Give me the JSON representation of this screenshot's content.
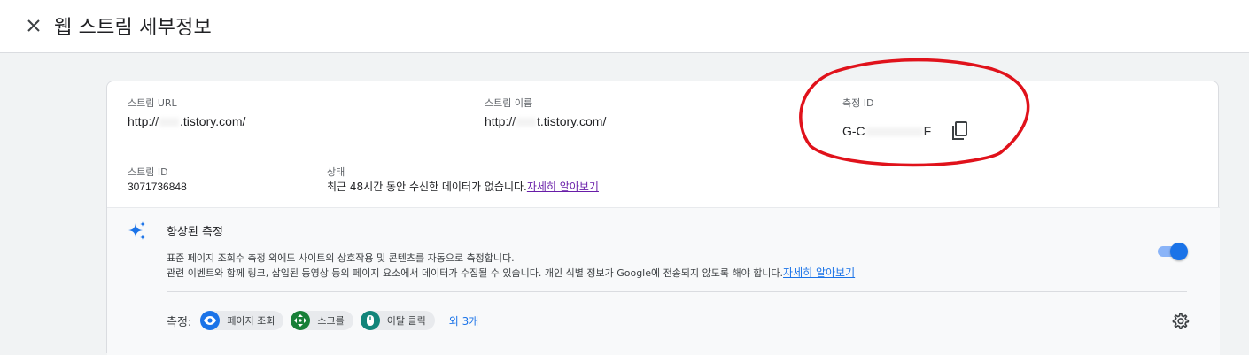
{
  "header": {
    "title": "웹 스트림 세부정보",
    "close_icon": "close-icon"
  },
  "stream": {
    "url_label": "스트림 URL",
    "url_prefix": "http://",
    "url_suffix": ".tistory.com/",
    "name_label": "스트림 이름",
    "name_prefix": "http://",
    "name_suffix": "t.tistory.com/",
    "measurement_label": "측정 ID",
    "measurement_prefix": "G-C",
    "measurement_suffix": "F",
    "id_label": "스트림 ID",
    "id_value": "3071736848",
    "status_label": "상태",
    "status_text": "최근 48시간 동안 수신한 데이터가 없습니다.",
    "status_link": "자세히 알아보기"
  },
  "enhanced": {
    "title": "향상된 측정",
    "desc_line1": "표준 페이지 조회수 측정 외에도 사이트의 상호작용 및 콘텐츠를 자동으로 측정합니다.",
    "desc_line2": "관련 이벤트와 함께 링크, 삽입된 동영상 등의 페이지 요소에서 데이터가 수집될 수 있습니다. 개인 식별 정보가 Google에 전송되지 않도록 해야 합니다.",
    "desc_link": "자세히 알아보기",
    "toggle_on": true,
    "events_label": "측정:",
    "chips": [
      {
        "label": "페이지 조회",
        "icon": "eye-icon",
        "color": "#1a73e8"
      },
      {
        "label": "스크롤",
        "icon": "scroll-arrows-icon",
        "color": "#188038"
      },
      {
        "label": "이탈 클릭",
        "icon": "mouse-icon",
        "color": "#12b5cb"
      }
    ],
    "more": "외 3개"
  },
  "colors": {
    "accent": "#1a73e8",
    "annotation": "#e0121b",
    "link_visited": "#681da8"
  }
}
